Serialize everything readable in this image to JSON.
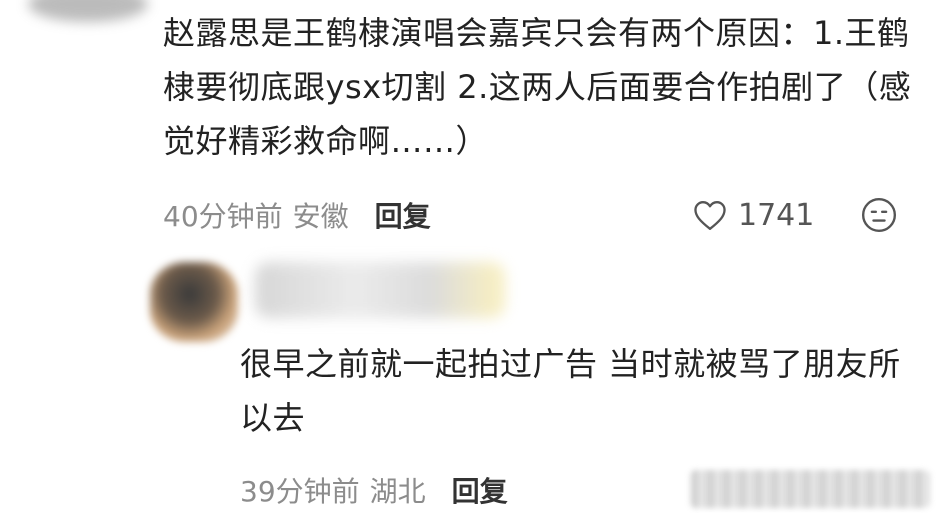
{
  "comment": {
    "text": "赵露思是王鹤棣演唱会嘉宾只会有两个原因：1.王鹤棣要彻底跟ysx切割 2.这两人后面要合作拍剧了（感觉好精彩救命啊……）",
    "time": "40分钟前",
    "location": "安徽",
    "reply_label": "回复",
    "like_count": "1741",
    "like_icon": "heart-outline-icon",
    "react_icon": "face-icon"
  },
  "reply": {
    "text": "很早之前就一起拍过广告 当时就被骂了朋友所以去",
    "time": "39分钟前",
    "location": "湖北",
    "reply_label": "回复"
  }
}
